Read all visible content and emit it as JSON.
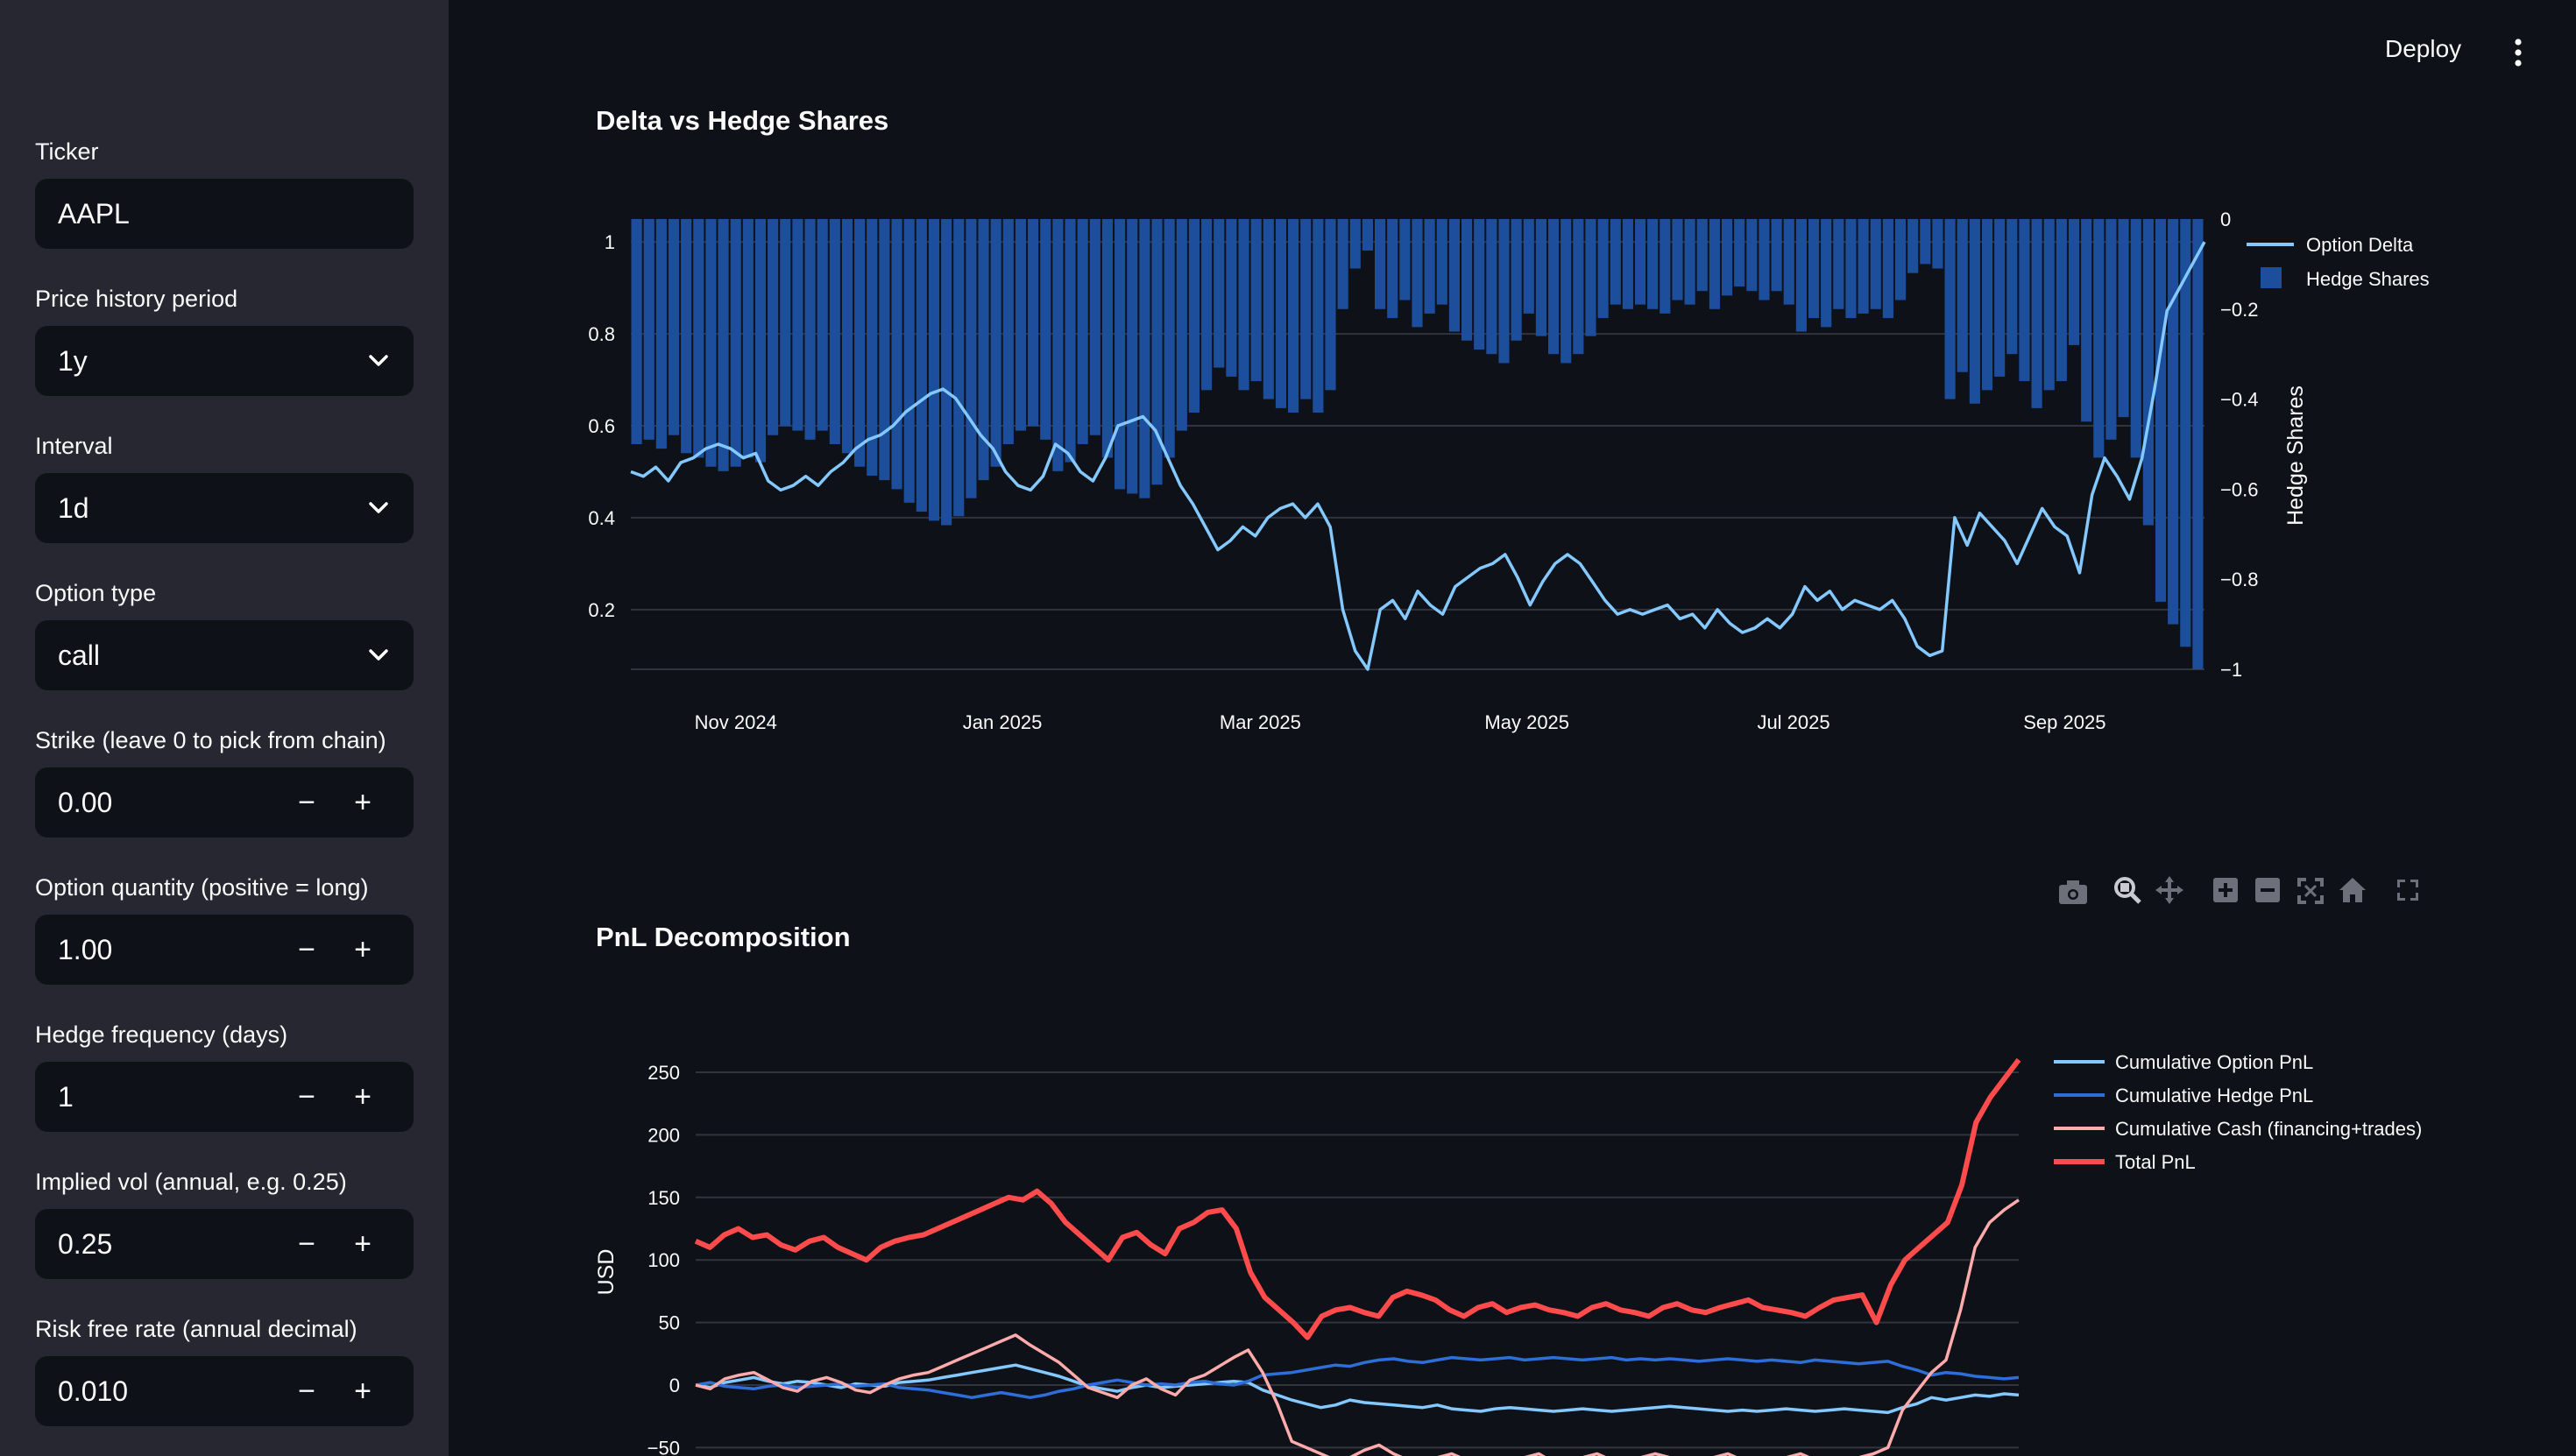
{
  "header": {
    "deploy_label": "Deploy"
  },
  "sidebar": {
    "ticker": {
      "label": "Ticker",
      "value": "AAPL"
    },
    "period": {
      "label": "Price history period",
      "value": "1y"
    },
    "interval": {
      "label": "Interval",
      "value": "1d"
    },
    "option_type": {
      "label": "Option type",
      "value": "call"
    },
    "strike": {
      "label": "Strike (leave 0 to pick from chain)",
      "value": "0.00"
    },
    "quantity": {
      "label": "Option quantity (positive = long)",
      "value": "1.00"
    },
    "hedge_freq": {
      "label": "Hedge frequency (days)",
      "value": "1"
    },
    "implied_vol": {
      "label": "Implied vol (annual, e.g. 0.25)",
      "value": "0.25"
    },
    "risk_free": {
      "label": "Risk free rate (annual decimal)",
      "value": "0.010"
    },
    "minus": "−",
    "plus": "+"
  },
  "colors": {
    "delta": "#83c9ff",
    "hedge": "#1c4e9b",
    "option_pnl": "#83c9ff",
    "hedge_pnl": "#2d6ed8",
    "cash": "#ffabab",
    "total": "#ff4b4b"
  },
  "toolbar_icons": [
    "camera-icon",
    "zoom-icon",
    "pan-icon",
    "zoom-in-icon",
    "zoom-out-icon",
    "autoscale-icon",
    "reset-icon",
    "fullscreen-icon"
  ],
  "chart_data": [
    {
      "type": "line+bar",
      "title": "Delta vs Hedge Shares",
      "x_ticks": [
        "Nov 2024",
        "Jan 2025",
        "Mar 2025",
        "May 2025",
        "Jul 2025",
        "Sep 2025"
      ],
      "x_range": [
        "2024-10-08",
        "2025-10-03"
      ],
      "y_ticks": [
        "0.2",
        "0.4",
        "0.6",
        "0.8",
        "1"
      ],
      "ylim": [
        0.07,
        1.05
      ],
      "y2_ticks": [
        "0",
        "−0.2",
        "−0.4",
        "−0.6",
        "−0.8",
        "−1"
      ],
      "y2lim": [
        -1,
        0
      ],
      "y2label": "Hedge Shares",
      "legend_position": "top-right",
      "series": [
        {
          "name": "Option Delta",
          "kind": "line",
          "values": [
            0.5,
            0.49,
            0.51,
            0.48,
            0.52,
            0.53,
            0.55,
            0.56,
            0.55,
            0.53,
            0.54,
            0.48,
            0.46,
            0.47,
            0.49,
            0.47,
            0.5,
            0.52,
            0.55,
            0.57,
            0.58,
            0.6,
            0.63,
            0.65,
            0.67,
            0.68,
            0.66,
            0.62,
            0.58,
            0.55,
            0.5,
            0.47,
            0.46,
            0.49,
            0.56,
            0.54,
            0.5,
            0.48,
            0.53,
            0.6,
            0.61,
            0.62,
            0.59,
            0.53,
            0.47,
            0.43,
            0.38,
            0.33,
            0.35,
            0.38,
            0.36,
            0.4,
            0.42,
            0.43,
            0.4,
            0.43,
            0.38,
            0.2,
            0.11,
            0.07,
            0.2,
            0.22,
            0.18,
            0.24,
            0.21,
            0.19,
            0.25,
            0.27,
            0.29,
            0.3,
            0.32,
            0.27,
            0.21,
            0.26,
            0.3,
            0.32,
            0.3,
            0.26,
            0.22,
            0.19,
            0.2,
            0.19,
            0.2,
            0.21,
            0.18,
            0.19,
            0.16,
            0.2,
            0.17,
            0.15,
            0.16,
            0.18,
            0.16,
            0.19,
            0.25,
            0.22,
            0.24,
            0.2,
            0.22,
            0.21,
            0.2,
            0.22,
            0.18,
            0.12,
            0.1,
            0.11,
            0.4,
            0.34,
            0.41,
            0.38,
            0.35,
            0.3,
            0.36,
            0.42,
            0.38,
            0.36,
            0.28,
            0.45,
            0.53,
            0.49,
            0.44,
            0.53,
            0.68,
            0.85,
            0.9,
            0.95,
            1.0
          ]
        },
        {
          "name": "Hedge Shares",
          "kind": "bar",
          "values": [
            -0.5,
            -0.49,
            -0.51,
            -0.48,
            -0.52,
            -0.53,
            -0.55,
            -0.56,
            -0.55,
            -0.53,
            -0.54,
            -0.48,
            -0.46,
            -0.47,
            -0.49,
            -0.47,
            -0.5,
            -0.52,
            -0.55,
            -0.57,
            -0.58,
            -0.6,
            -0.63,
            -0.65,
            -0.67,
            -0.68,
            -0.66,
            -0.62,
            -0.58,
            -0.55,
            -0.5,
            -0.47,
            -0.46,
            -0.49,
            -0.56,
            -0.54,
            -0.5,
            -0.48,
            -0.53,
            -0.6,
            -0.61,
            -0.62,
            -0.59,
            -0.53,
            -0.47,
            -0.43,
            -0.38,
            -0.33,
            -0.35,
            -0.38,
            -0.36,
            -0.4,
            -0.42,
            -0.43,
            -0.4,
            -0.43,
            -0.38,
            -0.2,
            -0.11,
            -0.07,
            -0.2,
            -0.22,
            -0.18,
            -0.24,
            -0.21,
            -0.19,
            -0.25,
            -0.27,
            -0.29,
            -0.3,
            -0.32,
            -0.27,
            -0.21,
            -0.26,
            -0.3,
            -0.32,
            -0.3,
            -0.26,
            -0.22,
            -0.19,
            -0.2,
            -0.19,
            -0.2,
            -0.21,
            -0.18,
            -0.19,
            -0.16,
            -0.2,
            -0.17,
            -0.15,
            -0.16,
            -0.18,
            -0.16,
            -0.19,
            -0.25,
            -0.22,
            -0.24,
            -0.2,
            -0.22,
            -0.21,
            -0.2,
            -0.22,
            -0.18,
            -0.12,
            -0.1,
            -0.11,
            -0.4,
            -0.34,
            -0.41,
            -0.38,
            -0.35,
            -0.3,
            -0.36,
            -0.42,
            -0.38,
            -0.36,
            -0.28,
            -0.45,
            -0.53,
            -0.49,
            -0.44,
            -0.53,
            -0.68,
            -0.85,
            -0.9,
            -0.95,
            -1.0
          ]
        }
      ]
    },
    {
      "type": "line",
      "title": "PnL Decomposition",
      "ylabel": "USD",
      "y_ticks": [
        "−50",
        "0",
        "50",
        "100",
        "150",
        "200",
        "250"
      ],
      "ylim": [
        -50,
        270
      ],
      "legend_position": "top-right",
      "series": [
        {
          "name": "Cumulative Option PnL",
          "values": [
            0,
            -2,
            2,
            4,
            6,
            3,
            1,
            3,
            2,
            0,
            -2,
            1,
            0,
            -1,
            2,
            3,
            4,
            6,
            8,
            10,
            12,
            14,
            16,
            13,
            10,
            7,
            3,
            -1,
            -3,
            -5,
            -2,
            0,
            -2,
            -1,
            0,
            1,
            2,
            3,
            2,
            -4,
            -8,
            -12,
            -15,
            -18,
            -16,
            -12,
            -14,
            -15,
            -16,
            -17,
            -18,
            -16,
            -19,
            -20,
            -21,
            -19,
            -18,
            -19,
            -20,
            -21,
            -20,
            -19,
            -20,
            -21,
            -20,
            -19,
            -18,
            -17,
            -18,
            -19,
            -20,
            -21,
            -20,
            -21,
            -20,
            -19,
            -20,
            -21,
            -20,
            -19,
            -20,
            -21,
            -22,
            -18,
            -15,
            -10,
            -12,
            -10,
            -8,
            -9,
            -7,
            -8
          ]
        },
        {
          "name": "Cumulative Hedge PnL",
          "values": [
            0,
            2,
            -1,
            -2,
            -3,
            -1,
            0,
            -2,
            -1,
            0,
            1,
            -1,
            0,
            1,
            -2,
            -3,
            -4,
            -6,
            -8,
            -10,
            -8,
            -6,
            -8,
            -10,
            -8,
            -5,
            -3,
            0,
            2,
            4,
            2,
            0,
            1,
            0,
            2,
            3,
            1,
            0,
            3,
            8,
            9,
            10,
            12,
            14,
            16,
            15,
            18,
            20,
            21,
            19,
            18,
            20,
            22,
            21,
            20,
            21,
            22,
            20,
            21,
            22,
            21,
            20,
            21,
            22,
            20,
            21,
            20,
            21,
            20,
            19,
            20,
            21,
            20,
            19,
            20,
            19,
            18,
            20,
            19,
            18,
            17,
            18,
            19,
            15,
            12,
            8,
            10,
            9,
            7,
            6,
            5,
            6
          ]
        },
        {
          "name": "Cumulative Cash (financing+trades)",
          "values": [
            0,
            -3,
            5,
            8,
            10,
            4,
            -2,
            -5,
            3,
            6,
            2,
            -4,
            -6,
            0,
            5,
            8,
            10,
            15,
            20,
            25,
            30,
            35,
            40,
            32,
            25,
            18,
            8,
            -2,
            -6,
            -10,
            0,
            5,
            -3,
            -8,
            4,
            8,
            15,
            22,
            28,
            10,
            -15,
            -45,
            -50,
            -55,
            -60,
            -58,
            -52,
            -48,
            -55,
            -60,
            -62,
            -58,
            -55,
            -60,
            -62,
            -63,
            -60,
            -58,
            -55,
            -62,
            -60,
            -58,
            -55,
            -60,
            -62,
            -58,
            -55,
            -58,
            -60,
            -62,
            -58,
            -55,
            -60,
            -62,
            -60,
            -58,
            -55,
            -60,
            -62,
            -60,
            -58,
            -55,
            -50,
            -20,
            -5,
            10,
            20,
            60,
            110,
            130,
            140,
            148
          ]
        },
        {
          "name": "Total PnL",
          "values": [
            115,
            110,
            120,
            125,
            118,
            120,
            112,
            108,
            115,
            118,
            110,
            105,
            100,
            110,
            115,
            118,
            120,
            125,
            130,
            135,
            140,
            145,
            150,
            148,
            155,
            145,
            130,
            120,
            110,
            100,
            118,
            122,
            112,
            105,
            125,
            130,
            138,
            140,
            125,
            90,
            70,
            60,
            50,
            38,
            55,
            60,
            62,
            58,
            55,
            70,
            75,
            72,
            68,
            60,
            55,
            62,
            65,
            58,
            62,
            64,
            60,
            58,
            55,
            62,
            65,
            60,
            58,
            55,
            62,
            65,
            60,
            58,
            62,
            65,
            68,
            62,
            60,
            58,
            55,
            62,
            68,
            70,
            72,
            50,
            80,
            100,
            110,
            120,
            130,
            160,
            210,
            230,
            245,
            260
          ]
        }
      ]
    }
  ]
}
